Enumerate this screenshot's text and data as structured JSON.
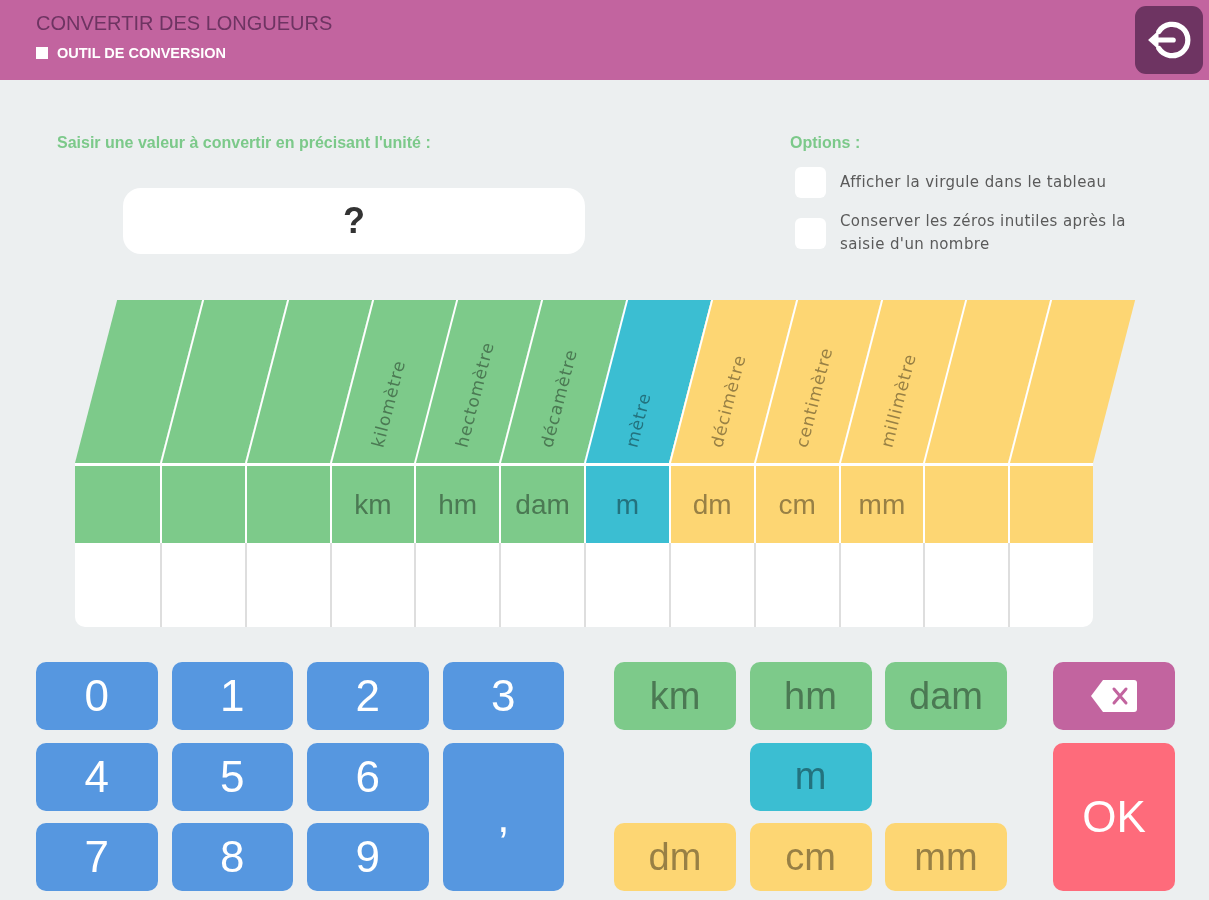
{
  "header": {
    "title": "CONVERTIR DES LONGUEURS",
    "subtitle": "OUTIL DE CONVERSION"
  },
  "entry": {
    "label": "Saisir une valeur à convertir en précisant l'unité :",
    "placeholder": "?"
  },
  "options": {
    "title": "Options :",
    "items": [
      {
        "label": "Afficher la virgule dans le tableau",
        "checked": false
      },
      {
        "label": "Conserver les zéros inutiles après la saisie d'un nombre",
        "checked": false
      }
    ]
  },
  "table": {
    "columns": [
      {
        "color": "#7dca8a"
      },
      {
        "color": "#7dca8a"
      },
      {
        "color": "#7dca8a"
      },
      {
        "name": "kilomètre",
        "unit": "km",
        "color": "#7dca8a"
      },
      {
        "name": "hectomètre",
        "unit": "hm",
        "color": "#7dca8a"
      },
      {
        "name": "décamètre",
        "unit": "dam",
        "color": "#7dca8a"
      },
      {
        "name": "mètre",
        "unit": "m",
        "color": "#3bbed2"
      },
      {
        "name": "décimètre",
        "unit": "dm",
        "color": "#fdd673"
      },
      {
        "name": "centimètre",
        "unit": "cm",
        "color": "#fdd673"
      },
      {
        "name": "millimètre",
        "unit": "mm",
        "color": "#fdd673"
      },
      {
        "color": "#fdd673"
      },
      {
        "color": "#fdd673"
      }
    ]
  },
  "keypad": [
    {
      "kind": "digit",
      "label": "0"
    },
    {
      "kind": "digit",
      "label": "1"
    },
    {
      "kind": "digit",
      "label": "2"
    },
    {
      "kind": "digit",
      "label": "3"
    },
    {
      "kind": "digit",
      "label": "4"
    },
    {
      "kind": "digit",
      "label": "5"
    },
    {
      "kind": "digit",
      "label": "6"
    },
    {
      "kind": "digit",
      "label": "7"
    },
    {
      "kind": "digit",
      "label": "8"
    },
    {
      "kind": "digit",
      "label": "9"
    },
    {
      "kind": "separator",
      "label": ","
    }
  ],
  "unit_buttons": [
    [
      {
        "label": "km",
        "color": "#7dca8a"
      },
      {
        "label": "hm",
        "color": "#7dca8a"
      },
      {
        "label": "dam",
        "color": "#7dca8a"
      }
    ],
    [
      {
        "label": "m",
        "color": "#3bbed2"
      }
    ],
    [
      {
        "label": "dm",
        "color": "#fdd673"
      },
      {
        "label": "cm",
        "color": "#fdd673"
      },
      {
        "label": "mm",
        "color": "#fdd673"
      }
    ]
  ],
  "actions": [
    {
      "kind": "erase"
    },
    {
      "kind": "confirm",
      "label": "OK"
    }
  ]
}
